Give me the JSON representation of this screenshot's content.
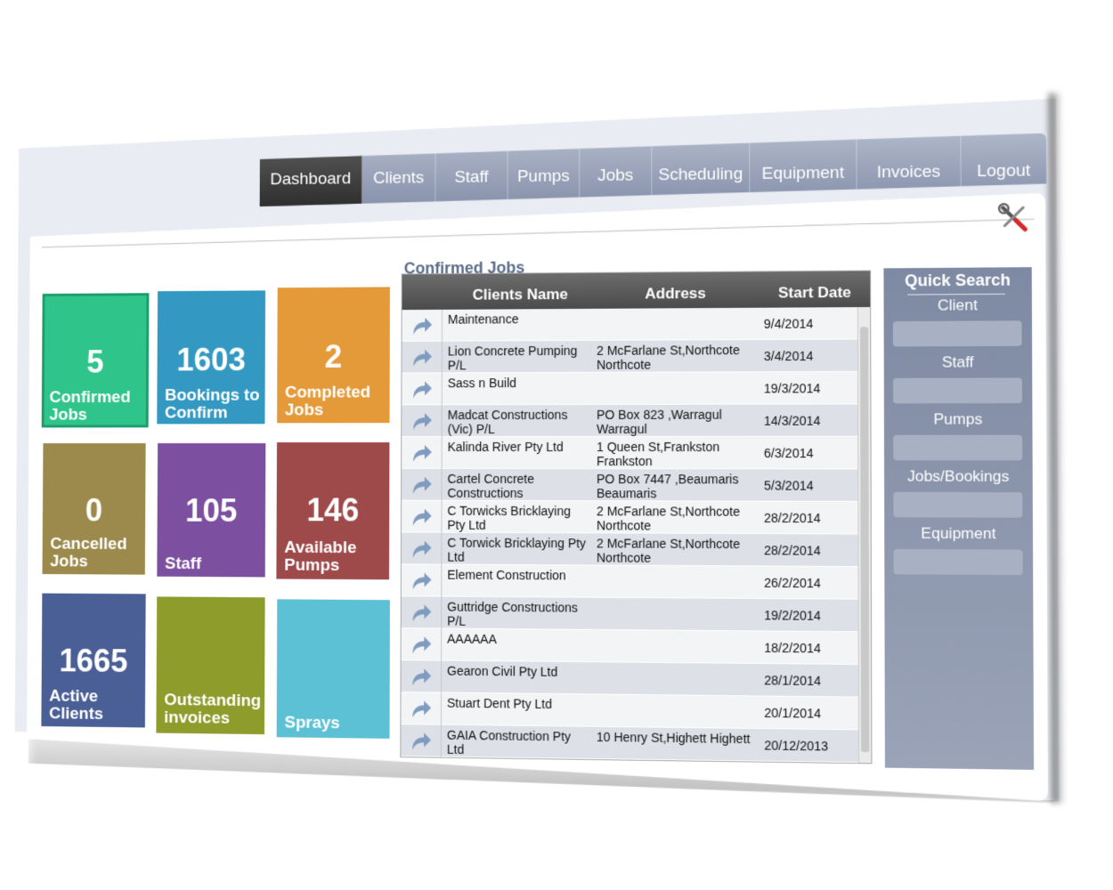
{
  "nav": {
    "items": [
      "Dashboard",
      "Clients",
      "Staff",
      "Pumps",
      "Jobs",
      "Scheduling",
      "Equipment",
      "Invoices",
      "Logout"
    ],
    "active": "Dashboard"
  },
  "tiles": [
    {
      "number": "5",
      "label1": "Confirmed",
      "label2": "Jobs",
      "color": "#2fc58a"
    },
    {
      "number": "1603",
      "label1": "Bookings to",
      "label2": "Confirm",
      "color": "#3399c2"
    },
    {
      "number": "2",
      "label1": "Completed",
      "label2": "Jobs",
      "color": "#e59a3a"
    },
    {
      "number": "0",
      "label1": "Cancelled",
      "label2": "Jobs",
      "color": "#9b8a4c"
    },
    {
      "number": "105",
      "label1": "Staff",
      "label2": "",
      "color": "#7c4fa0"
    },
    {
      "number": "146",
      "label1": "Available",
      "label2": "Pumps",
      "color": "#9e4a4b"
    },
    {
      "number": "1665",
      "label1": "Active",
      "label2": "Clients",
      "color": "#4a5f96"
    },
    {
      "number": "",
      "label1": "Outstanding",
      "label2": "invoices",
      "color": "#8d9c2b"
    },
    {
      "number": "",
      "label1": "Sprays",
      "label2": "",
      "color": "#5cc1d4"
    }
  ],
  "confirmed_jobs": {
    "title": "Confirmed Jobs",
    "headers": {
      "name": "Clients Name",
      "address": "Address",
      "date": "Start Date"
    },
    "rows": [
      {
        "name": "Maintenance",
        "address": "",
        "date": "9/4/2014"
      },
      {
        "name": "Lion Concrete Pumping P/L",
        "address": "2 McFarlane St,Northcote Northcote",
        "date": "3/4/2014"
      },
      {
        "name": "Sass n Build",
        "address": "",
        "date": "19/3/2014"
      },
      {
        "name": "Madcat Constructions (Vic) P/L",
        "address": "PO Box 823 ,Warragul Warragul",
        "date": "14/3/2014"
      },
      {
        "name": "Kalinda River Pty Ltd",
        "address": "1 Queen St,Frankston Frankston",
        "date": "6/3/2014"
      },
      {
        "name": "Cartel Concrete Constructions",
        "address": "PO Box 7447 ,Beaumaris Beaumaris",
        "date": "5/3/2014"
      },
      {
        "name": "C Torwicks Bricklaying Pty Ltd",
        "address": "2 McFarlane St,Northcote Northcote",
        "date": "28/2/2014"
      },
      {
        "name": "C Torwick Bricklaying Pty Ltd",
        "address": "2 McFarlane St,Northcote Northcote",
        "date": "28/2/2014"
      },
      {
        "name": "Element Construction",
        "address": "",
        "date": "26/2/2014"
      },
      {
        "name": "Guttridge Constructions P/L",
        "address": "",
        "date": "19/2/2014"
      },
      {
        "name": "AAAAAA",
        "address": "",
        "date": "18/2/2014"
      },
      {
        "name": "Gearon Civil Pty Ltd",
        "address": "",
        "date": "28/1/2014"
      },
      {
        "name": "Stuart Dent Pty Ltd",
        "address": "",
        "date": "20/1/2014"
      },
      {
        "name": "GAIA Construction Pty Ltd",
        "address": "10 Henry St,Highett Highett",
        "date": "20/12/2013"
      }
    ]
  },
  "quick_search": {
    "title": "Quick Search",
    "fields": [
      "Client",
      "Staff",
      "Pumps",
      "Jobs/Bookings",
      "Equipment"
    ]
  },
  "icons": {
    "tools": "tools-icon",
    "row_action": "forward-arrow-icon"
  }
}
